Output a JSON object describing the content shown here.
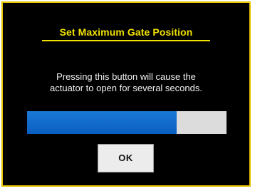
{
  "dialog": {
    "title": "Set Maximum Gate Position",
    "message": [
      "Pressing this button will cause the",
      "actuator to open for several seconds."
    ],
    "progress": 0.75,
    "ok_label": "OK"
  },
  "colors": {
    "background": "#000000",
    "border": "#e8c400",
    "title": "#f2e200",
    "text": "#f0f0f0",
    "progress_fill": "#0a6fd0",
    "progress_track": "#dcdcdc",
    "button": "#ececec"
  }
}
